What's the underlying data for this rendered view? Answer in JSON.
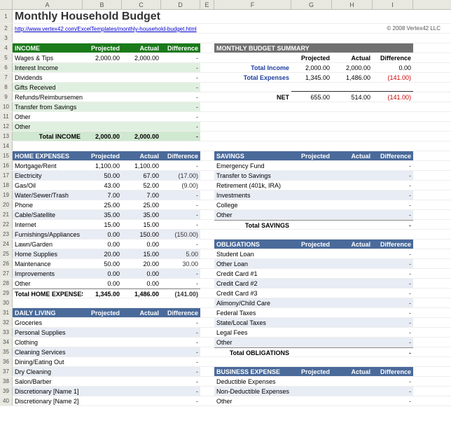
{
  "cols": [
    "A",
    "B",
    "C",
    "D",
    "E",
    "F",
    "G",
    "H",
    "I"
  ],
  "title": "Monthly Household Budget",
  "link": "http://www.vertex42.com/ExcelTemplates/monthly-household-budget.html",
  "copyright": "© 2008 Vertex42 LLC",
  "income": {
    "header": "INCOME",
    "cols": [
      "Projected",
      "Actual",
      "Difference"
    ],
    "rows": [
      {
        "label": "Wages & Tips",
        "p": "2,000.00",
        "a": "2,000.00",
        "d": "-"
      },
      {
        "label": "Interest Income",
        "p": "",
        "a": "",
        "d": "-"
      },
      {
        "label": "Dividends",
        "p": "",
        "a": "",
        "d": "-"
      },
      {
        "label": "Gifts Received",
        "p": "",
        "a": "",
        "d": "-"
      },
      {
        "label": "Refunds/Reimbursements",
        "p": "",
        "a": "",
        "d": "-"
      },
      {
        "label": "Transfer from Savings",
        "p": "",
        "a": "",
        "d": "-"
      },
      {
        "label": "Other",
        "p": "",
        "a": "",
        "d": "-"
      },
      {
        "label": "Other",
        "p": "",
        "a": "",
        "d": "-"
      }
    ],
    "total": {
      "label": "Total INCOME",
      "p": "2,000.00",
      "a": "2,000.00",
      "d": "-"
    }
  },
  "summary": {
    "header": "MONTHLY BUDGET SUMMARY",
    "cols": [
      "Projected",
      "Actual",
      "Difference"
    ],
    "rows": [
      {
        "label": "Total Income",
        "p": "2,000.00",
        "a": "2,000.00",
        "d": "0.00",
        "neg": false
      },
      {
        "label": "Total Expenses",
        "p": "1,345.00",
        "a": "1,486.00",
        "d": "(141.00)",
        "neg": true
      }
    ],
    "net": {
      "label": "NET",
      "p": "655.00",
      "a": "514.00",
      "d": "(141.00)",
      "neg": true
    }
  },
  "home": {
    "header": "HOME EXPENSES",
    "cols": [
      "Projected",
      "Actual",
      "Difference"
    ],
    "rows": [
      {
        "label": "Mortgage/Rent",
        "p": "1,100.00",
        "a": "1,100.00",
        "d": "-"
      },
      {
        "label": "Electricity",
        "p": "50.00",
        "a": "67.00",
        "d": "(17.00)",
        "neg": true
      },
      {
        "label": "Gas/Oil",
        "p": "43.00",
        "a": "52.00",
        "d": "(9.00)",
        "neg": true
      },
      {
        "label": "Water/Sewer/Trash",
        "p": "7.00",
        "a": "7.00",
        "d": "-"
      },
      {
        "label": "Phone",
        "p": "25.00",
        "a": "25.00",
        "d": "-"
      },
      {
        "label": "Cable/Satellite",
        "p": "35.00",
        "a": "35.00",
        "d": "-"
      },
      {
        "label": "Internet",
        "p": "15.00",
        "a": "15.00",
        "d": "-"
      },
      {
        "label": "Furnishings/Appliances",
        "p": "0.00",
        "a": "150.00",
        "d": "(150.00)",
        "neg": true
      },
      {
        "label": "Lawn/Garden",
        "p": "0.00",
        "a": "0.00",
        "d": "-"
      },
      {
        "label": "Home Supplies",
        "p": "20.00",
        "a": "15.00",
        "d": "5.00"
      },
      {
        "label": "Maintenance",
        "p": "50.00",
        "a": "20.00",
        "d": "30.00"
      },
      {
        "label": "Improvements",
        "p": "0.00",
        "a": "0.00",
        "d": "-"
      },
      {
        "label": "Other",
        "p": "0.00",
        "a": "0.00",
        "d": "-"
      }
    ],
    "total": {
      "label": "Total HOME EXPENSES",
      "p": "1,345.00",
      "a": "1,486.00",
      "d": "(141.00)",
      "neg": true
    }
  },
  "savings": {
    "header": "SAVINGS",
    "cols": [
      "Projected",
      "Actual",
      "Difference"
    ],
    "rows": [
      {
        "label": "Emergency Fund",
        "d": "-"
      },
      {
        "label": "Transfer to Savings",
        "d": "-"
      },
      {
        "label": "Retirement (401k, IRA)",
        "d": "-"
      },
      {
        "label": "Investments",
        "d": "-"
      },
      {
        "label": "College",
        "d": "-"
      },
      {
        "label": "Other",
        "d": "-"
      }
    ],
    "total": {
      "label": "Total SAVINGS",
      "p": "",
      "a": "",
      "d": "-"
    }
  },
  "obligations": {
    "header": "OBLIGATIONS",
    "cols": [
      "Projected",
      "Actual",
      "Difference"
    ],
    "rows": [
      {
        "label": "Student Loan",
        "d": "-"
      },
      {
        "label": "Other Loan",
        "d": "-"
      },
      {
        "label": "Credit Card #1",
        "d": "-"
      },
      {
        "label": "Credit Card #2",
        "d": "-"
      },
      {
        "label": "Credit Card #3",
        "d": "-"
      },
      {
        "label": "Alimony/Child Care",
        "d": "-"
      },
      {
        "label": "Federal Taxes",
        "d": "-"
      },
      {
        "label": "State/Local Taxes",
        "d": "-"
      },
      {
        "label": "Legal Fees",
        "d": "-"
      },
      {
        "label": "Other",
        "d": "-"
      }
    ],
    "total": {
      "label": "Total OBLIGATIONS",
      "p": "",
      "a": "",
      "d": "-"
    }
  },
  "daily": {
    "header": "DAILY LIVING",
    "cols": [
      "Projected",
      "Actual",
      "Difference"
    ],
    "rows": [
      {
        "label": "Groceries",
        "d": "-"
      },
      {
        "label": "Personal Supplies",
        "d": "-"
      },
      {
        "label": "Clothing",
        "d": "-"
      },
      {
        "label": "Cleaning Services",
        "d": "-"
      },
      {
        "label": "Dining/Eating Out",
        "d": "-"
      },
      {
        "label": "Dry Cleaning",
        "d": "-"
      },
      {
        "label": "Salon/Barber",
        "d": "-"
      },
      {
        "label": "Discretionary [Name 1]",
        "d": "-"
      },
      {
        "label": "Discretionary [Name 2]",
        "d": "-"
      }
    ]
  },
  "business": {
    "header": "BUSINESS EXPENSE",
    "cols": [
      "Projected",
      "Actual",
      "Difference"
    ],
    "rows": [
      {
        "label": "Deductible Expenses",
        "d": "-"
      },
      {
        "label": "Non-Deductible Expenses",
        "d": "-"
      },
      {
        "label": "Other",
        "d": "-"
      }
    ]
  }
}
